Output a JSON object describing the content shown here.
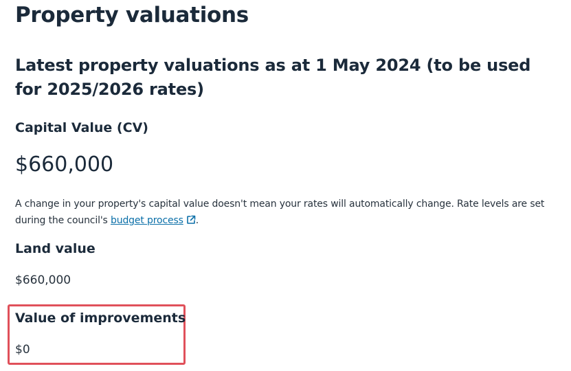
{
  "page": {
    "title": "Property valuations"
  },
  "valuations": {
    "heading": "Latest property valuations as at 1 May 2024 (to be used for 2025/2026 rates)",
    "capital_value": {
      "label": "Capital Value (CV)",
      "value": "$660,000",
      "note_before": "A change in your property's capital value doesn't mean your rates will automatically change. Rate levels are set during the council's ",
      "note_link": "budget process",
      "note_after": ".",
      "link_icon": "external-link-icon"
    },
    "land_value": {
      "label": "Land value",
      "value": "$660,000"
    },
    "improvements": {
      "label": "Value of improvements",
      "value": "$0",
      "highlight_color": "#e0505a"
    }
  },
  "colors": {
    "text": "#1b2a3a",
    "link": "#0b6fa8"
  }
}
